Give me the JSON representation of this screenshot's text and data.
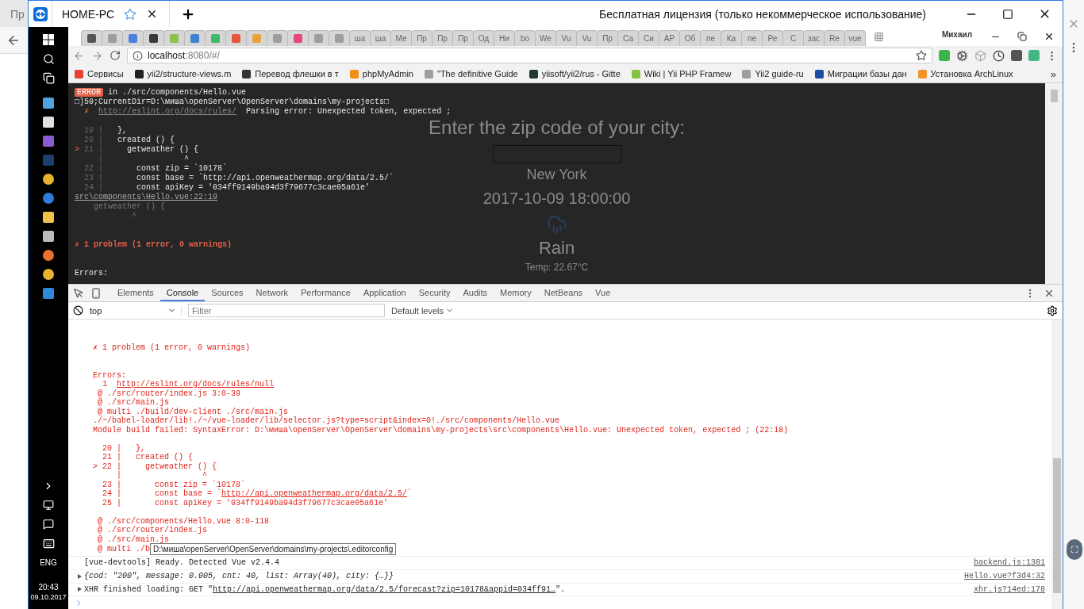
{
  "host": {
    "tab_label": "Пр"
  },
  "remote_window": {
    "tab_title": "HOME-PC",
    "license": "Бесплатная лицензия (только некоммерческое использование)"
  },
  "taskbar": {
    "language": "ENG",
    "time": "20:43",
    "date": "09.10.2017"
  },
  "browser": {
    "tabs": [
      {
        "kind": "icon",
        "color": "#555555"
      },
      {
        "kind": "icon",
        "color": "#9e9e9e"
      },
      {
        "kind": "icon",
        "color": "#4a7fe0"
      },
      {
        "kind": "icon",
        "color": "#3a3a3a"
      },
      {
        "kind": "icon",
        "color": "#8bc34a"
      },
      {
        "kind": "icon",
        "color": "#3f7fd0"
      },
      {
        "kind": "icon",
        "color": "#3dbb6a"
      },
      {
        "kind": "icon",
        "color": "#e8543c"
      },
      {
        "kind": "icon",
        "color": "#e9a23b"
      },
      {
        "kind": "icon",
        "color": "#9e9e9e"
      },
      {
        "kind": "icon",
        "color": "#e2497a"
      },
      {
        "kind": "icon",
        "color": "#9e9e9e"
      },
      {
        "kind": "icon",
        "color": "#9e9e9e"
      },
      {
        "kind": "text",
        "label": "ша"
      },
      {
        "kind": "text",
        "label": "ша"
      },
      {
        "kind": "text",
        "label": "Ме"
      },
      {
        "kind": "text",
        "label": "Пр"
      },
      {
        "kind": "text",
        "label": "Пр"
      },
      {
        "kind": "text",
        "label": "Пр"
      },
      {
        "kind": "text",
        "label": "Од"
      },
      {
        "kind": "text",
        "label": "Ни"
      },
      {
        "kind": "text",
        "label": "bo"
      },
      {
        "kind": "text",
        "label": "We"
      },
      {
        "kind": "text",
        "label": "Vu"
      },
      {
        "kind": "text",
        "label": "Vu"
      },
      {
        "kind": "text",
        "label": "Пр"
      },
      {
        "kind": "text",
        "label": "Са"
      },
      {
        "kind": "text",
        "label": "Си"
      },
      {
        "kind": "text",
        "label": "АР"
      },
      {
        "kind": "text",
        "label": "Об"
      },
      {
        "kind": "text",
        "label": "пе"
      },
      {
        "kind": "text",
        "label": "Ка"
      },
      {
        "kind": "text",
        "label": "пе"
      },
      {
        "kind": "text",
        "label": "Ре"
      },
      {
        "kind": "text",
        "label": "С"
      },
      {
        "kind": "text",
        "label": "зас"
      },
      {
        "kind": "text",
        "label": "Re"
      },
      {
        "kind": "text",
        "label": "vue"
      }
    ],
    "profile": "Михаил",
    "url_host": "localhost",
    "url_rest": ":8080/#/",
    "bookmarks": [
      {
        "label": "Сервисы",
        "color": "#e94235"
      },
      {
        "label": "yii2/structure-views.m",
        "color": "#222222"
      },
      {
        "label": "Перевод флешки в т",
        "color": "#333333"
      },
      {
        "label": "phpMyAdmin",
        "color": "#f29111"
      },
      {
        "label": "\"The definitive Guide",
        "color": "#9e9e9e"
      },
      {
        "label": "yiisoft/yii2/rus - Gitte",
        "color": "#1f3a2e"
      },
      {
        "label": "Wiki | Yii PHP Framew",
        "color": "#84c341"
      },
      {
        "label": "Yii2 guide-ru",
        "color": "#9e9e9e"
      },
      {
        "label": "Миграции базы дан",
        "color": "#1d4ca0"
      },
      {
        "label": "Установка ArchLinux",
        "color": "#f0932b"
      }
    ],
    "bookmarks_more": "»"
  },
  "error_overlay": {
    "badge": "ERROR",
    "file": "in ./src/components/Hello.vue",
    "lines": [
      {
        "kind": "plain",
        "text": "□]50;CurrentDir=D:\\миша\\openServer\\OpenServer\\domains\\my-projects□"
      },
      {
        "kind": "rule",
        "mark": "✗",
        "link": "http://eslint.org/docs/rules/",
        "text": "Parsing error: Unexpected token, expected ;"
      },
      {
        "kind": "blank"
      },
      {
        "kind": "code",
        "gutter": "19 |",
        "text": "  },"
      },
      {
        "kind": "code",
        "gutter": "20 |",
        "text": "  created () {"
      },
      {
        "kind": "code",
        "marker": ">",
        "gutter": "21 |",
        "text": "    getweather () {"
      },
      {
        "kind": "code",
        "gutter": "|",
        "text": "                ^"
      },
      {
        "kind": "code",
        "gutter": "22 |",
        "text": "      const zip = `10178`"
      },
      {
        "kind": "code",
        "gutter": "23 |",
        "text": "      const base = `http://api.openweathermap.org/data/2.5/`"
      },
      {
        "kind": "code",
        "gutter": "24 |",
        "text": "      const apiKey = '034ff9149ba94d3f79677c3cae05a61e'"
      },
      {
        "kind": "location",
        "text": "src\\components\\Hello.vue:22:19"
      },
      {
        "kind": "dim",
        "text": "    getweather () {"
      },
      {
        "kind": "dim",
        "text": "            ^"
      },
      {
        "kind": "blank"
      },
      {
        "kind": "blank"
      },
      {
        "kind": "problem",
        "mark": "✗",
        "text": "1 problem (1 error, 0 warnings)"
      },
      {
        "kind": "blank"
      },
      {
        "kind": "blank"
      },
      {
        "kind": "plain",
        "text": "Errors:"
      }
    ]
  },
  "page": {
    "heading": "Enter the zip code of your city:",
    "city": "New York",
    "datetime": "2017-10-09 18:00:00",
    "condition": "Rain",
    "temperature": "Temp: 22.67°C"
  },
  "devtools": {
    "tabs": [
      {
        "label": "Elements",
        "selected": false
      },
      {
        "label": "Console",
        "selected": true
      },
      {
        "label": "Sources",
        "selected": false
      },
      {
        "label": "Network",
        "selected": false
      },
      {
        "label": "Performance",
        "selected": false
      },
      {
        "label": "Application",
        "selected": false
      },
      {
        "label": "Security",
        "selected": false
      },
      {
        "label": "Audits",
        "selected": false
      },
      {
        "label": "Memory",
        "selected": false
      },
      {
        "label": "NetBeans",
        "selected": false
      },
      {
        "label": "Vue",
        "selected": false
      }
    ],
    "context": "top",
    "filter_placeholder": "Filter",
    "levels": "Default levels",
    "error_lines": [
      {
        "kind": "blank"
      },
      {
        "kind": "blank"
      },
      {
        "kind": "problem",
        "mark": "✗",
        "text": "1 problem (1 error, 0 warnings)"
      },
      {
        "kind": "blank"
      },
      {
        "kind": "blank"
      },
      {
        "kind": "plain",
        "text": "Errors:"
      },
      {
        "kind": "link",
        "prefix": "  1  ",
        "link": "http://eslint.org/docs/rules/null"
      },
      {
        "kind": "plain",
        "text": " @ ./src/router/index.js 3:0-39"
      },
      {
        "kind": "plain",
        "text": " @ ./src/main.js"
      },
      {
        "kind": "plain",
        "text": " @ multi ./build/dev-client ./src/main.js"
      },
      {
        "kind": "plain",
        "text": "./~/babel-loader/lib!./~/vue-loader/lib/selector.js?type=script&index=0!./src/components/Hello.vue"
      },
      {
        "kind": "plain",
        "text": "Module build failed: SyntaxError: D:\\миша\\openServer\\OpenServer\\domains\\my-projects\\src\\components\\Hello.vue: Unexpected token, expected ; (22:18)"
      },
      {
        "kind": "blank"
      },
      {
        "kind": "plain",
        "text": "  20 |   },"
      },
      {
        "kind": "plain",
        "text": "  21 |   created () {"
      },
      {
        "kind": "plain",
        "text": "> 22 |     getweather () {"
      },
      {
        "kind": "plain",
        "text": "     |                 ^"
      },
      {
        "kind": "plain",
        "text": "  23 |       const zip = `10178`"
      },
      {
        "kind": "link",
        "prefix": "  24 |       const base = `",
        "link": "http://api.openweathermap.org/data/2.5/",
        "suffix": "`"
      },
      {
        "kind": "plain",
        "text": "  25 |       const apiKey = '034ff9149ba94d3f79677c3cae05a61e'"
      },
      {
        "kind": "blank"
      },
      {
        "kind": "plain",
        "text": " @ ./src/components/Hello.vue 8:0-118"
      },
      {
        "kind": "plain",
        "text": " @ ./src/router/index.js"
      },
      {
        "kind": "plain",
        "text": " @ ./src/main.js"
      },
      {
        "kind": "plain",
        "text": " @ multi ./b"
      }
    ],
    "tooltip": "D:\\миша\\openServer\\OpenServer\\domains\\my-projects\\.editorconfig",
    "messages": [
      {
        "kind": "text",
        "expandable": false,
        "text": "[vue-devtools] Ready. Detected Vue v2.4.4",
        "source": "backend.js:1381"
      },
      {
        "kind": "object",
        "expandable": true,
        "text": "{cod: \"200\", message: 0.005, cnt: 40, list: Array(40), city: {…}}",
        "source": "Hello.vue?f3d4:32"
      },
      {
        "kind": "link",
        "expandable": true,
        "prefix": "XHR finished loading: GET \"",
        "link": "http://api.openweathermap.org/data/2.5/forecast?zip=10178&appid=034ff91…",
        "suffix": "\".",
        "source": "xhr.js?14ed:178"
      }
    ]
  }
}
